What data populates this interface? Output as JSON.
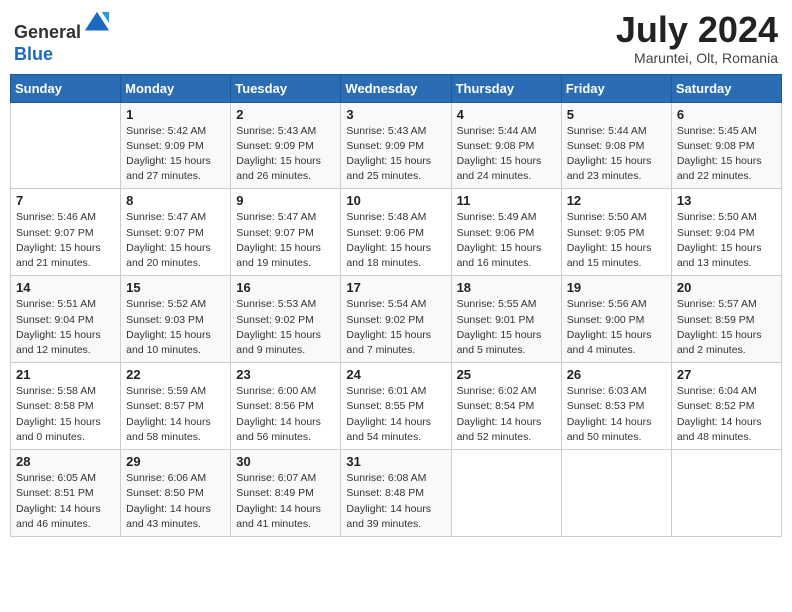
{
  "header": {
    "logo_line1": "General",
    "logo_line2": "Blue",
    "month_year": "July 2024",
    "location": "Maruntei, Olt, Romania"
  },
  "weekdays": [
    "Sunday",
    "Monday",
    "Tuesday",
    "Wednesday",
    "Thursday",
    "Friday",
    "Saturday"
  ],
  "weeks": [
    [
      {
        "day": "",
        "info": ""
      },
      {
        "day": "1",
        "info": "Sunrise: 5:42 AM\nSunset: 9:09 PM\nDaylight: 15 hours\nand 27 minutes."
      },
      {
        "day": "2",
        "info": "Sunrise: 5:43 AM\nSunset: 9:09 PM\nDaylight: 15 hours\nand 26 minutes."
      },
      {
        "day": "3",
        "info": "Sunrise: 5:43 AM\nSunset: 9:09 PM\nDaylight: 15 hours\nand 25 minutes."
      },
      {
        "day": "4",
        "info": "Sunrise: 5:44 AM\nSunset: 9:08 PM\nDaylight: 15 hours\nand 24 minutes."
      },
      {
        "day": "5",
        "info": "Sunrise: 5:44 AM\nSunset: 9:08 PM\nDaylight: 15 hours\nand 23 minutes."
      },
      {
        "day": "6",
        "info": "Sunrise: 5:45 AM\nSunset: 9:08 PM\nDaylight: 15 hours\nand 22 minutes."
      }
    ],
    [
      {
        "day": "7",
        "info": "Sunrise: 5:46 AM\nSunset: 9:07 PM\nDaylight: 15 hours\nand 21 minutes."
      },
      {
        "day": "8",
        "info": "Sunrise: 5:47 AM\nSunset: 9:07 PM\nDaylight: 15 hours\nand 20 minutes."
      },
      {
        "day": "9",
        "info": "Sunrise: 5:47 AM\nSunset: 9:07 PM\nDaylight: 15 hours\nand 19 minutes."
      },
      {
        "day": "10",
        "info": "Sunrise: 5:48 AM\nSunset: 9:06 PM\nDaylight: 15 hours\nand 18 minutes."
      },
      {
        "day": "11",
        "info": "Sunrise: 5:49 AM\nSunset: 9:06 PM\nDaylight: 15 hours\nand 16 minutes."
      },
      {
        "day": "12",
        "info": "Sunrise: 5:50 AM\nSunset: 9:05 PM\nDaylight: 15 hours\nand 15 minutes."
      },
      {
        "day": "13",
        "info": "Sunrise: 5:50 AM\nSunset: 9:04 PM\nDaylight: 15 hours\nand 13 minutes."
      }
    ],
    [
      {
        "day": "14",
        "info": "Sunrise: 5:51 AM\nSunset: 9:04 PM\nDaylight: 15 hours\nand 12 minutes."
      },
      {
        "day": "15",
        "info": "Sunrise: 5:52 AM\nSunset: 9:03 PM\nDaylight: 15 hours\nand 10 minutes."
      },
      {
        "day": "16",
        "info": "Sunrise: 5:53 AM\nSunset: 9:02 PM\nDaylight: 15 hours\nand 9 minutes."
      },
      {
        "day": "17",
        "info": "Sunrise: 5:54 AM\nSunset: 9:02 PM\nDaylight: 15 hours\nand 7 minutes."
      },
      {
        "day": "18",
        "info": "Sunrise: 5:55 AM\nSunset: 9:01 PM\nDaylight: 15 hours\nand 5 minutes."
      },
      {
        "day": "19",
        "info": "Sunrise: 5:56 AM\nSunset: 9:00 PM\nDaylight: 15 hours\nand 4 minutes."
      },
      {
        "day": "20",
        "info": "Sunrise: 5:57 AM\nSunset: 8:59 PM\nDaylight: 15 hours\nand 2 minutes."
      }
    ],
    [
      {
        "day": "21",
        "info": "Sunrise: 5:58 AM\nSunset: 8:58 PM\nDaylight: 15 hours\nand 0 minutes."
      },
      {
        "day": "22",
        "info": "Sunrise: 5:59 AM\nSunset: 8:57 PM\nDaylight: 14 hours\nand 58 minutes."
      },
      {
        "day": "23",
        "info": "Sunrise: 6:00 AM\nSunset: 8:56 PM\nDaylight: 14 hours\nand 56 minutes."
      },
      {
        "day": "24",
        "info": "Sunrise: 6:01 AM\nSunset: 8:55 PM\nDaylight: 14 hours\nand 54 minutes."
      },
      {
        "day": "25",
        "info": "Sunrise: 6:02 AM\nSunset: 8:54 PM\nDaylight: 14 hours\nand 52 minutes."
      },
      {
        "day": "26",
        "info": "Sunrise: 6:03 AM\nSunset: 8:53 PM\nDaylight: 14 hours\nand 50 minutes."
      },
      {
        "day": "27",
        "info": "Sunrise: 6:04 AM\nSunset: 8:52 PM\nDaylight: 14 hours\nand 48 minutes."
      }
    ],
    [
      {
        "day": "28",
        "info": "Sunrise: 6:05 AM\nSunset: 8:51 PM\nDaylight: 14 hours\nand 46 minutes."
      },
      {
        "day": "29",
        "info": "Sunrise: 6:06 AM\nSunset: 8:50 PM\nDaylight: 14 hours\nand 43 minutes."
      },
      {
        "day": "30",
        "info": "Sunrise: 6:07 AM\nSunset: 8:49 PM\nDaylight: 14 hours\nand 41 minutes."
      },
      {
        "day": "31",
        "info": "Sunrise: 6:08 AM\nSunset: 8:48 PM\nDaylight: 14 hours\nand 39 minutes."
      },
      {
        "day": "",
        "info": ""
      },
      {
        "day": "",
        "info": ""
      },
      {
        "day": "",
        "info": ""
      }
    ]
  ]
}
